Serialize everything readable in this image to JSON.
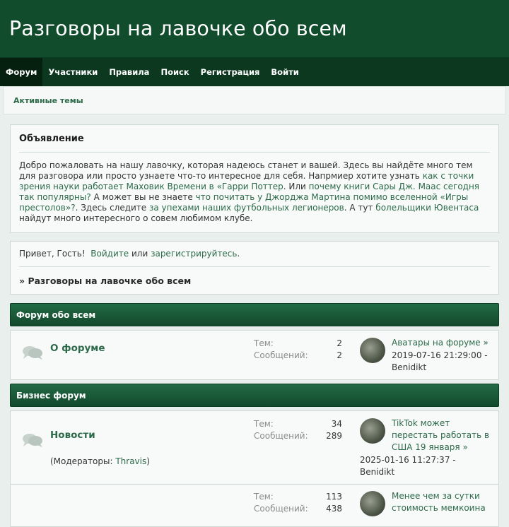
{
  "header": {
    "title": "Разговоры на лавочке обо всем"
  },
  "nav": {
    "items": [
      {
        "label": "Форум",
        "active": true
      },
      {
        "label": "Участники"
      },
      {
        "label": "Правила"
      },
      {
        "label": "Поиск"
      },
      {
        "label": "Регистрация"
      },
      {
        "label": "Войти"
      }
    ]
  },
  "subnav": {
    "link": "Активные темы"
  },
  "announcement": {
    "title": "Объявление",
    "t1": "Добро пожаловать на нашу лавочку, которая надеюсь станет и вашей. Здесь вы найдёте много тем для разговора или просто узнаете что-то интересное для себя. Напрмиер хотите узнать ",
    "l1": "как с точки зрения науки работает Маховик Времени в «Гарри Поттер",
    "t2": ". Или ",
    "l2": "почему книги Сары Дж. Маас сегодня так популярны?",
    "t3": " А может вы не знаете ",
    "l3": "что почитать у Джорджа Мартина помимо вселенной «Игры престолов»?",
    "t4": ". Здесь следите ",
    "l4": "за упехами наших футбольных легионеров",
    "t5": ". А тут ",
    "l5": "болельщики Ювентаса",
    "t6": " найдут много интересного о совем любимом клубе."
  },
  "welcome": {
    "greeting": "Привет, Гость!",
    "login": "Войдите",
    "or": "или",
    "register": "зарегистрируйтесь",
    "dot": ".",
    "breadcrumb_prefix": "»",
    "breadcrumb": "Разговоры на лавочке обо всем"
  },
  "categories": [
    {
      "title": "Форум обо всем",
      "forums": [
        {
          "name": "О форуме",
          "topics_label": "Тем:",
          "topics": "2",
          "posts_label": "Сообщений:",
          "posts": "2",
          "last_title": "Аватары на форуме",
          "last_date": "2019-07-16 21:29:00 -",
          "last_user": "Benidikt"
        }
      ]
    },
    {
      "title": "Бизнес форум",
      "forums": [
        {
          "name": "Новости",
          "moderators_label": "(Модераторы:",
          "moderator": "Thravis",
          "moderators_close": ")",
          "topics_label": "Тем:",
          "topics": "34",
          "posts_label": "Сообщений:",
          "posts": "289",
          "last_title": "TikTok может перестать работать в США 19 января",
          "last_date": "2025-01-16 11:27:37 -",
          "last_user": "Benidikt"
        },
        {
          "topics_label": "Тем:",
          "topics": "113",
          "posts_label": "Сообщений:",
          "posts": "438",
          "last_title": "Менее чем за сутки стоимость мемкоина"
        }
      ]
    }
  ],
  "arrow": "»",
  "colors": {
    "header": "#114d2d",
    "nav": "#0c3820",
    "link": "#2c6a4a",
    "category_bar": "#1a5a38"
  }
}
